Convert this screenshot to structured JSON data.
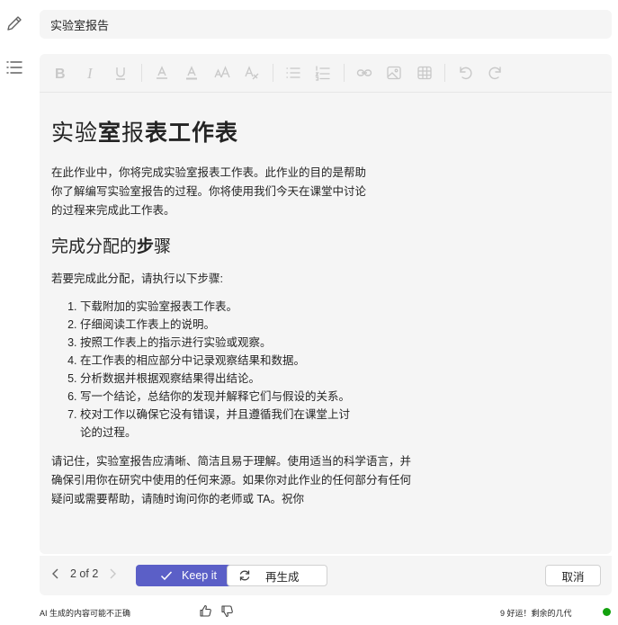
{
  "title_field": {
    "value": "实验室报告"
  },
  "toolbar": {
    "buttons": [
      "bold-icon",
      "italic-icon",
      "underline-icon",
      "highlight-icon",
      "font-color-icon",
      "font-size-icon",
      "clear-format-icon",
      "bullet-list-icon",
      "numbered-list-icon",
      "link-icon",
      "image-icon",
      "table-icon",
      "undo-icon",
      "redo-icon"
    ]
  },
  "document": {
    "title_light": "实验",
    "title_mid": "室",
    "title_light2": "报",
    "title_bold": "表工作表",
    "intro": "在此作业中，你将完成实验室报表工作表。此作业的目的是帮助你了解编写实验室报告的过程。你将使用我们今天在课堂中讨论的过程来完成此工作表。",
    "section_heading_light": "完成分配的",
    "section_heading_bold": "步",
    "section_heading_light2": "骤",
    "steps_intro": "若要完成此分配，请执行以下步骤:",
    "steps": [
      "下载附加的实验室报表工作表。",
      "仔细阅读工作表上的说明。",
      "按照工作表上的指示进行实验或观察。",
      "在工作表的相应部分中记录观察结果和数据。",
      "分析数据并根据观察结果得出结论。",
      "写一个结论，总结你的发现并解释它们与假设的关系。",
      "校对工作以确保它没有错误，并且遵循我们在课堂上讨论的过程。"
    ],
    "closing": "请记住，实验室报告应清晰、简洁且易于理解。使用适当的科学语言，并确保引用你在研究中使用的任何来源。如果你对此作业的任何部分有任何疑问或需要帮助，请随时询问你的老师或 TA。祝你"
  },
  "actions": {
    "pager": "2 of 2",
    "keep_label": "Keep it",
    "regenerate_label": "再生成",
    "cancel_label": "取消"
  },
  "footer": {
    "disclaimer": "AI 生成的内容可能不正确",
    "usage": "9 好运！剩余的几代"
  },
  "colors": {
    "accent": "#5b5fc7",
    "status": "#13a10e"
  }
}
